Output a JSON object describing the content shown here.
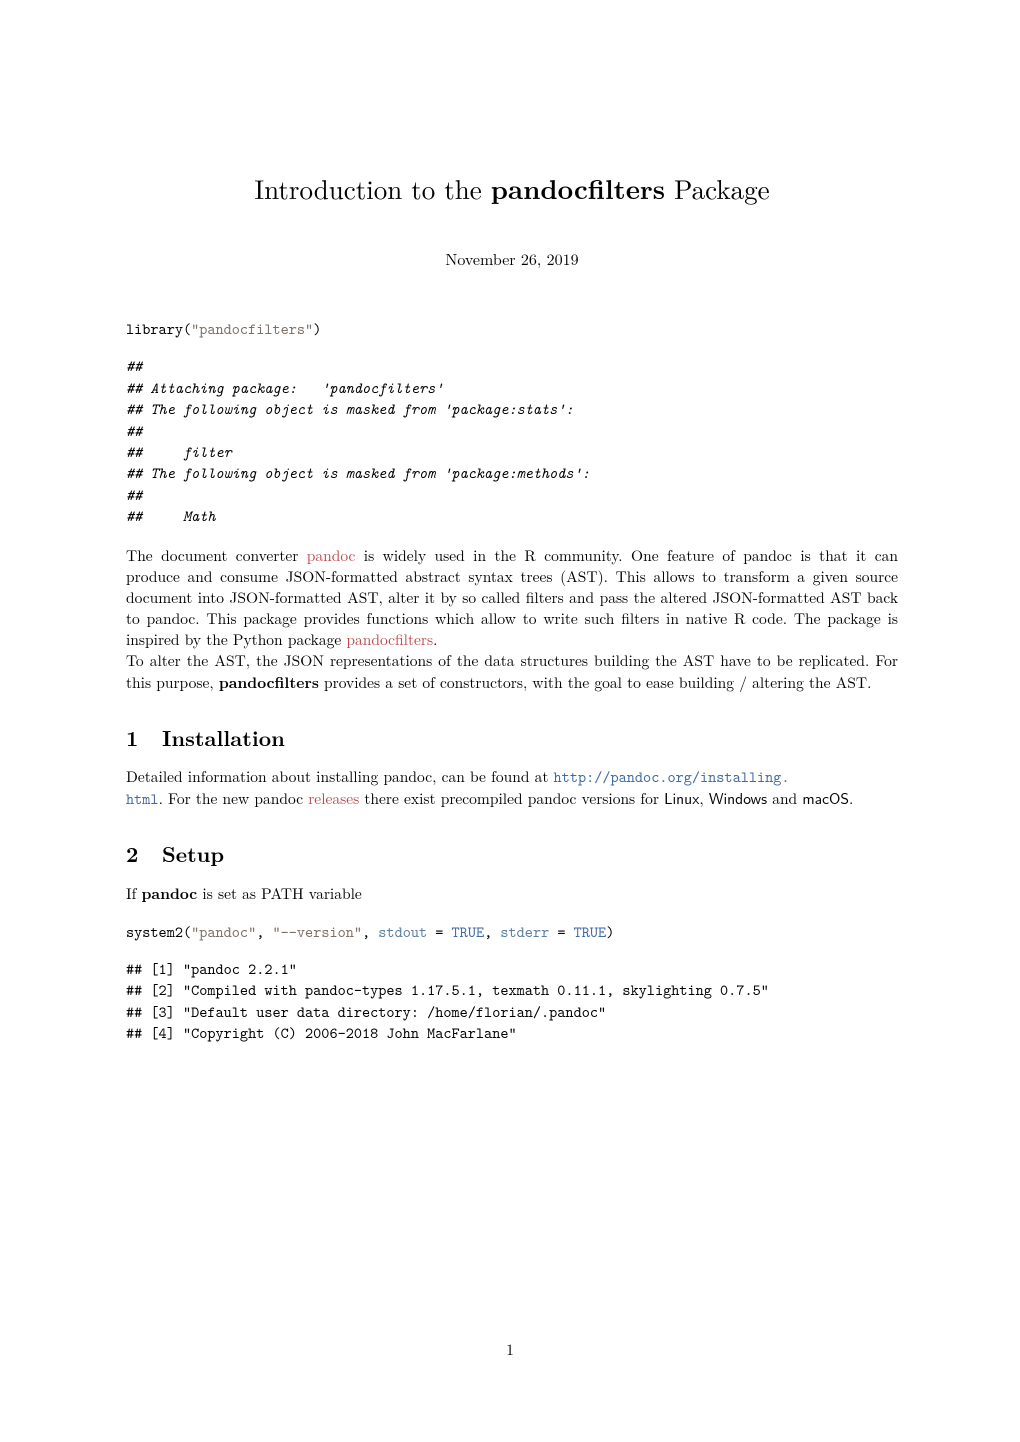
{
  "title_prefix": "Introduction to the ",
  "title_bold": "pandocfilters",
  "title_suffix": " Package",
  "date": "November 26, 2019",
  "code1": {
    "line": "library(\"pandocfilters\")",
    "out": [
      "##",
      "## Attaching package:   'pandocfilters'",
      "## The following object is masked from 'package:stats':",
      "##",
      "##     filter",
      "## The following object is masked from 'package:methods':",
      "##",
      "##     Math"
    ]
  },
  "para1": {
    "t1": "The document converter ",
    "link1": "pandoc",
    "t2": " is widely used in the R community. One feature of pandoc is that it can produce and consume JSON-formatted abstract syntax trees (AST). This allows to transform a given source document into JSON-formatted AST, alter it by so called filters and pass the altered JSON-formatted AST back to pandoc. This package provides functions which allow to write such filters in native R code. The package is inspired by the Python package ",
    "link2": "pandocfilters",
    "t3": "."
  },
  "para2": {
    "t1": "To alter the AST, the JSON representations of the data structures building the AST have to be replicated. For this purpose, ",
    "bold": "pandocfilters",
    "t2": " provides a set of constructors, with the goal to ease building / altering the AST."
  },
  "sec1": {
    "num": "1",
    "title": "Installation"
  },
  "para3": {
    "t1": "Detailed information about installing pandoc, can be found at ",
    "url1": "http://pandoc.org/installing.",
    "url2": "html",
    "t2": ". For the new pandoc ",
    "link1": "releases",
    "t3": " there exist precompiled pandoc versions for ",
    "sf1": "Linux",
    "t4": ", ",
    "sf2": "Windows",
    "t5": " and ",
    "sf3": "macOS",
    "t6": "."
  },
  "sec2": {
    "num": "2",
    "title": "Setup"
  },
  "para4": {
    "t1": "If ",
    "bold": "pandoc",
    "t2": " is set as PATH variable"
  },
  "code2": {
    "fn": "system2",
    "lp": "(",
    "s1": "\"pandoc\"",
    "c1": ", ",
    "s2": "\"--version\"",
    "c2": ", ",
    "a1": "stdout",
    "eq1": " = ",
    "k1": "TRUE",
    "c3": ", ",
    "a2": "stderr",
    "eq2": " = ",
    "k2": "TRUE",
    "rp": ")",
    "out": [
      "## [1] \"pandoc 2.2.1\"",
      "## [2] \"Compiled with pandoc-types 1.17.5.1, texmath 0.11.1, skylighting 0.7.5\"",
      "## [3] \"Default user data directory: /home/florian/.pandoc\"",
      "## [4] \"Copyright (C) 2006-2018 John MacFarlane\""
    ]
  },
  "pagenum": "1"
}
